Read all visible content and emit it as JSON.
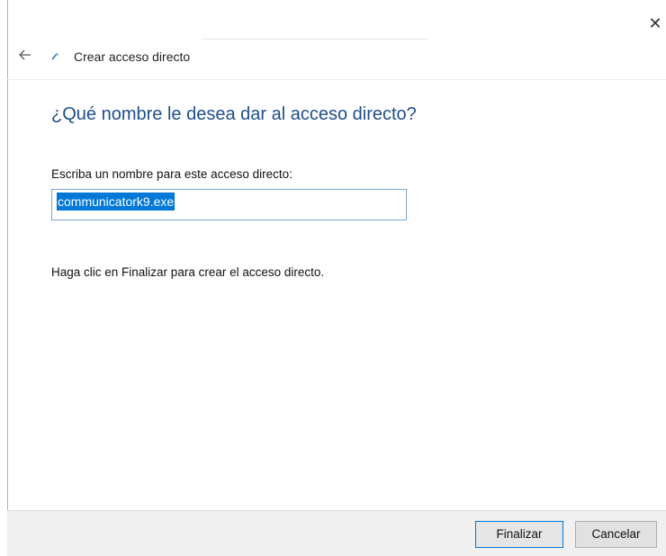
{
  "window": {
    "close_glyph": "✕",
    "back_icon": "arrow-left-icon",
    "wizard_icon": "shortcut-wizard-icon"
  },
  "header": {
    "title": "Crear acceso directo"
  },
  "main": {
    "heading": "¿Qué nombre le desea dar al acceso directo?",
    "name_label": "Escriba un nombre para este acceso directo:",
    "name_value": "communicatork9.exe",
    "hint": "Haga clic en Finalizar para crear el acceso directo."
  },
  "footer": {
    "finish_label": "Finalizar",
    "cancel_label": "Cancelar"
  },
  "colors": {
    "accent": "#0078d7",
    "heading": "#1e4e8c",
    "footer_bg": "#f0f0f0"
  }
}
